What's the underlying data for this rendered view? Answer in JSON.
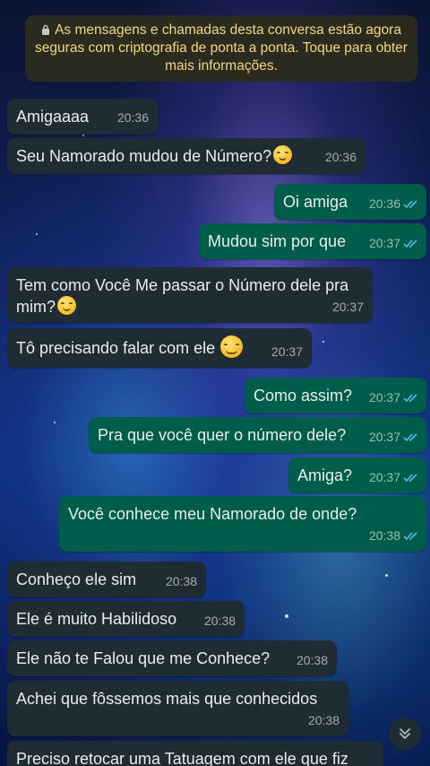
{
  "notice": {
    "text": "As mensagens e chamadas desta conversa estão agora seguras com criptografia de ponta a ponta. Toque para obter mais informações.",
    "icon": "lock-icon"
  },
  "messages": [
    {
      "direction": "in",
      "text": "Amigaaaa",
      "time": "20:36"
    },
    {
      "direction": "in",
      "text": "Seu Namorado mudou de Número?",
      "emoji": "smiling-face-emoji",
      "time": "20:36"
    },
    {
      "direction": "out",
      "text": "Oi amiga",
      "time": "20:36",
      "status": "read"
    },
    {
      "direction": "out",
      "text": "Mudou sim por que",
      "time": "20:37",
      "status": "read"
    },
    {
      "direction": "in",
      "text": "Tem como Você Me passar o Número dele pra mim?",
      "emoji": "smiling-face-emoji",
      "time": "20:37"
    },
    {
      "direction": "in",
      "text": "Tô precisando falar com ele",
      "emoji": "blushing-face-emoji",
      "time": "20:37"
    },
    {
      "direction": "out",
      "text": "Como assim?",
      "time": "20:37",
      "status": "read"
    },
    {
      "direction": "out",
      "text": "Pra que você quer o número dele?",
      "time": "20:37",
      "status": "read"
    },
    {
      "direction": "out",
      "text": "Amiga?",
      "time": "20:37",
      "status": "read"
    },
    {
      "direction": "out",
      "text": "Você conhece meu Namorado de onde?",
      "time": "20:38",
      "status": "read"
    },
    {
      "direction": "in",
      "text": "Conheço ele sim",
      "time": "20:38"
    },
    {
      "direction": "in",
      "text": "Ele é muito Habilidoso",
      "time": "20:38"
    },
    {
      "direction": "in",
      "text": "Ele não te Falou que me Conhece?",
      "time": "20:38"
    },
    {
      "direction": "in",
      "text": "Achei que fôssemos mais que conhecidos",
      "time": "20:38"
    },
    {
      "direction": "in",
      "text": "Preciso retocar uma Tatuagem com ele que fiz"
    }
  ],
  "colors": {
    "incoming_bubble": "#1f2c34",
    "outgoing_bubble": "#005c4b",
    "read_ticks": "#53bdeb",
    "notice_text": "#f3d780"
  },
  "scroll_button": {
    "icon": "double-chevron-down-icon"
  }
}
